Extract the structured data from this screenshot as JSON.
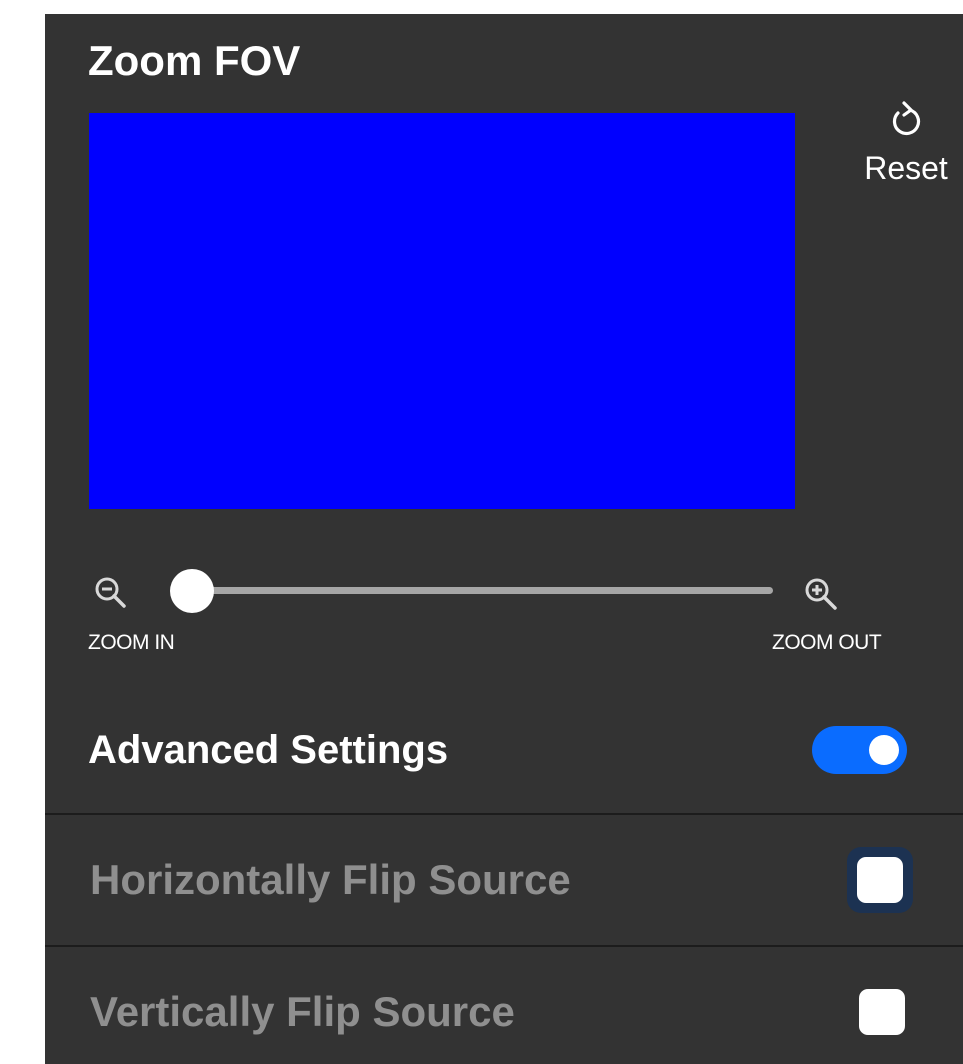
{
  "panel": {
    "title": "Zoom FOV",
    "preview_color": "#0000ff"
  },
  "reset": {
    "icon": "reset-icon",
    "label": "Reset"
  },
  "zoom": {
    "zoom_in_icon": "zoom-in-icon",
    "zoom_out_icon": "zoom-out-icon",
    "zoom_in_label": "ZOOM IN",
    "zoom_out_label": "ZOOM OUT",
    "slider_value": 0
  },
  "advanced": {
    "label": "Advanced Settings",
    "enabled": true,
    "toggle_color": "#0a6cff"
  },
  "options": [
    {
      "label": "Horizontally Flip Source",
      "checked": false,
      "focused": true
    },
    {
      "label": "Vertically Flip Source",
      "checked": false,
      "focused": false
    }
  ]
}
